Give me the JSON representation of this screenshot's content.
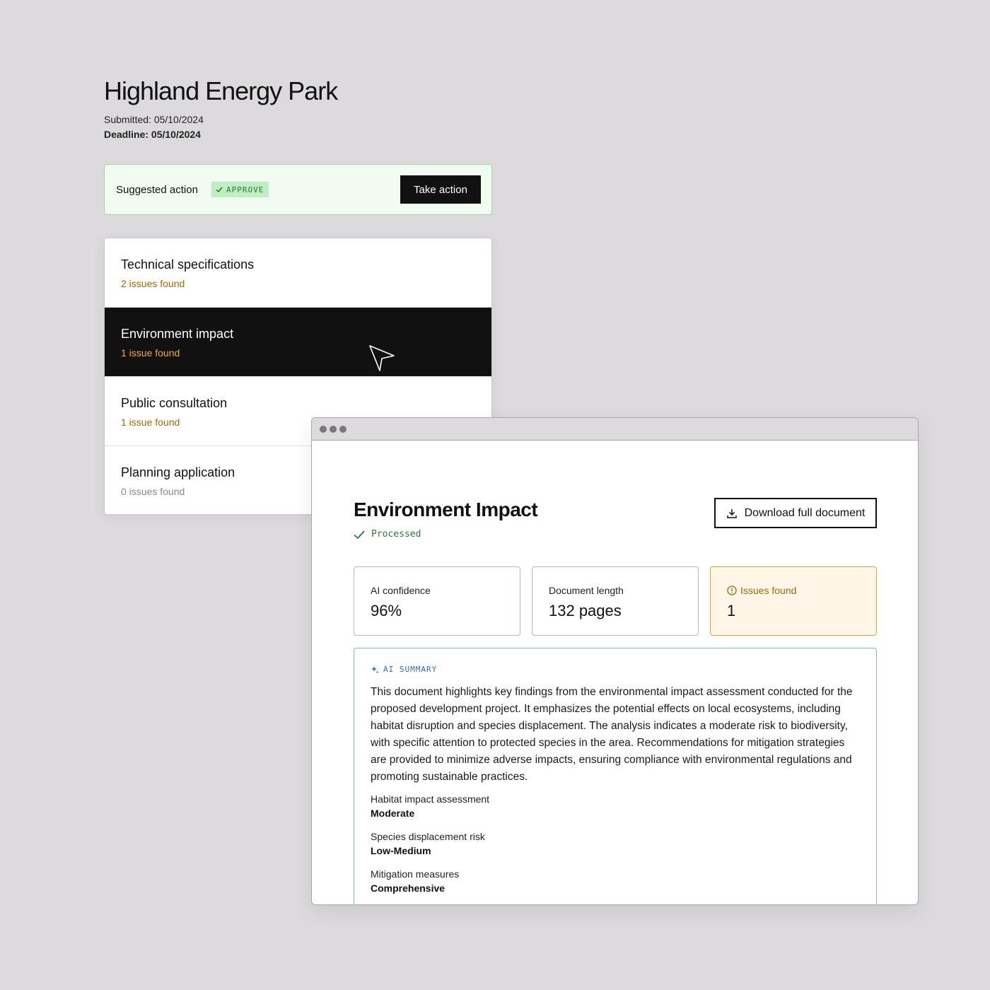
{
  "project": {
    "title": "Highland Energy Park",
    "submitted": "Submitted: 05/10/2024",
    "deadline": "Deadline: 05/10/2024"
  },
  "suggestion": {
    "label": "Suggested action",
    "badge": "APPROVE",
    "button": "Take action"
  },
  "sections": [
    {
      "name": "Technical specifications",
      "issues": "2 issues found"
    },
    {
      "name": "Environment impact",
      "issues": "1 issue found"
    },
    {
      "name": "Public consultation",
      "issues": "1 issue found"
    },
    {
      "name": "Planning application",
      "issues": "0 issues found"
    }
  ],
  "document": {
    "title": "Environment Impact",
    "status": "Processed",
    "download": "Download full document",
    "stats": [
      {
        "label": "AI confidence",
        "value": "96%"
      },
      {
        "label": "Document length",
        "value": "132 pages"
      },
      {
        "label": "Issues found",
        "value": "1"
      }
    ],
    "summary": {
      "tag": "AI SUMMARY",
      "text": "This document highlights key findings from the environmental impact assessment conducted for the proposed development project. It emphasizes the potential effects on local ecosystems, including habitat disruption and species displacement. The analysis indicates a moderate risk to biodiversity, with specific attention to protected species in the area. Recommendations for mitigation strategies are provided to minimize adverse impacts, ensuring compliance with environmental regulations and promoting sustainable practices.",
      "items": [
        {
          "key": "Habitat impact assessment",
          "value": "Moderate"
        },
        {
          "key": "Species displacement risk",
          "value": "Low-Medium"
        },
        {
          "key": "Mitigation measures",
          "value": "Comprehensive"
        }
      ]
    }
  },
  "colors": {
    "background": "#dcdadd",
    "approve_bg": "#bfeec3",
    "approve_text": "#2a7a36",
    "issue_text": "#a36b00",
    "issue_active": "#f2a93b",
    "ai_blue": "#2a6fc0",
    "warn_bg": "#fff6e8"
  },
  "icons": [
    "check-icon",
    "cursor-arrow-icon",
    "download-icon",
    "alert-circle-icon",
    "sparkle-icon"
  ]
}
